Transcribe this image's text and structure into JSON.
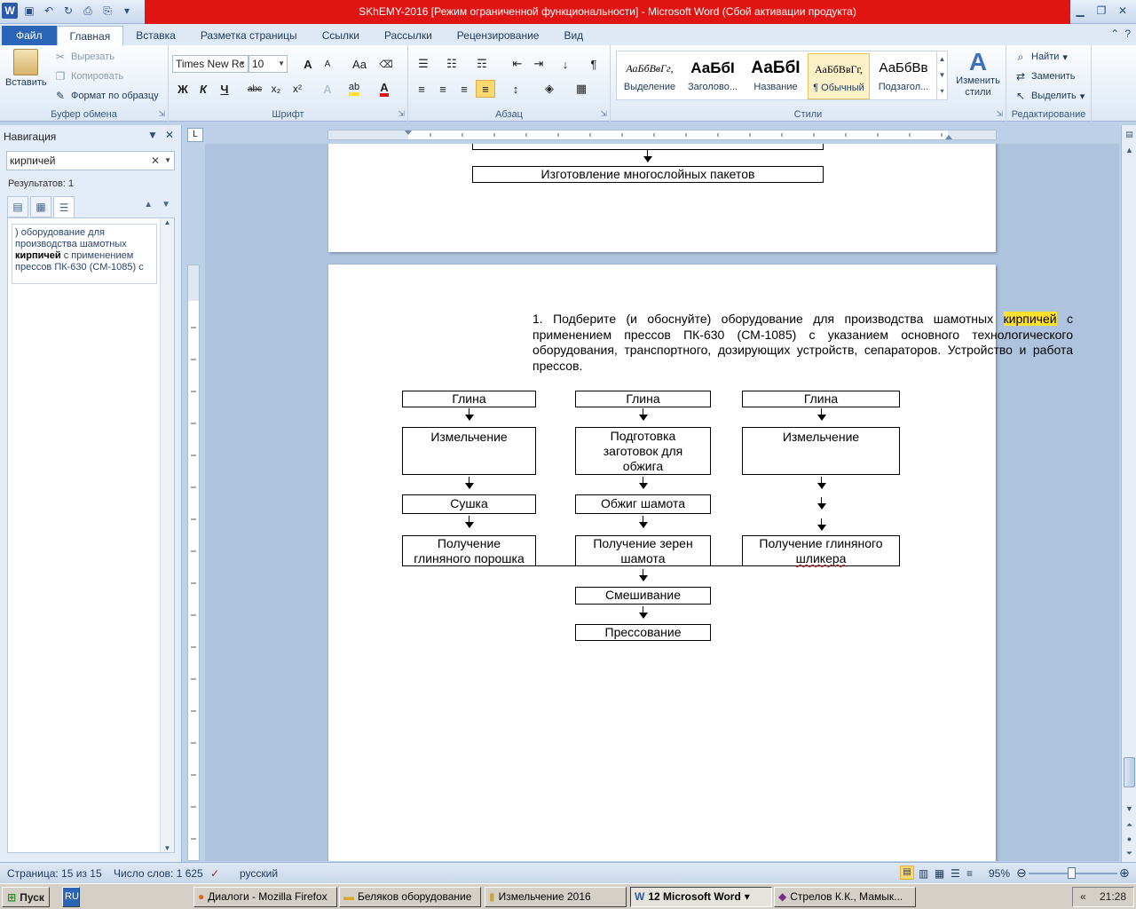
{
  "window": {
    "title": "SKhEMY-2016 [Режим ограниченной функциональности]  -  Microsoft Word (Сбой активации продукта)"
  },
  "tabs": [
    "Файл",
    "Главная",
    "Вставка",
    "Разметка страницы",
    "Ссылки",
    "Рассылки",
    "Рецензирование",
    "Вид"
  ],
  "clipboard": {
    "paste": "Вставить",
    "cut": "Вырезать",
    "copy": "Копировать",
    "format_painter": "Формат по образцу",
    "label": "Буфер обмена"
  },
  "font": {
    "name": "Times New Rc",
    "size": "10",
    "label": "Шрифт",
    "bold": "Ж",
    "italic": "К",
    "underline": "Ч",
    "strike": "abc",
    "subscript": "x₂",
    "superscript": "x²",
    "grow": "A",
    "shrink": "A",
    "case": "Aa",
    "font_color": "A"
  },
  "paragraph": {
    "label": "Абзац",
    "pilcrow": "¶"
  },
  "styles": {
    "label": "Стили",
    "items": [
      {
        "sample": "АаБбВвГг,",
        "name": "Выделение"
      },
      {
        "sample": "АаБбI",
        "name": "Заголово..."
      },
      {
        "sample": "АаБбI",
        "name": "Название"
      },
      {
        "sample": "АаБбВвГг,",
        "name": "¶ Обычный"
      },
      {
        "sample": "АаБбВв",
        "name": "Подзагол..."
      }
    ],
    "change": "Изменить стили"
  },
  "editing": {
    "label": "Редактирование",
    "find": "Найти",
    "replace": "Заменить",
    "select": "Выделить"
  },
  "navigation": {
    "title": "Навигация",
    "search_value": "кирпичей",
    "results": "Результатов: 1",
    "result_pre": ") оборудование для производства шамотных ",
    "result_bold": "кирпичей",
    "result_post": " с применением прессов ПК-630 (СМ-1085) с"
  },
  "document": {
    "prev_page_box": "Изготовление многослойных пакетов",
    "para_pre": "1. Подберите (и обоснуйте) оборудование для производства шамотных ",
    "para_highlight": "кирпичей",
    "para_post": " с применением прессов ПК-630 (СМ-1085) с указанием основного технологического оборудования, транспортного, дозирующих устройств, сепараторов. Устройство и работа прессов.",
    "col1": [
      "Глина",
      "Измельчение",
      "Сушка",
      "Получение глиняного порошка"
    ],
    "col2": [
      "Глина",
      "Подготовка заготовок для обжига",
      "Обжиг шамота",
      "Получение зерен шамота"
    ],
    "col3": [
      "Глина",
      "Измельчение",
      "Получение глиняного ",
      "шликера"
    ],
    "mix": "Смешивание",
    "press": "Прессование"
  },
  "status": {
    "page": "Страница: 15 из 15",
    "words": "Число слов: 1 625",
    "lang": "русский",
    "zoom": "95%"
  },
  "taskbar": {
    "start": "Пуск",
    "lang": "RU",
    "items": [
      "Диалоги - Mozilla Firefox",
      "Беляков оборудование",
      "Измельчение 2016",
      "12 Microsoft Word",
      "Стрелов К.К., Мамык..."
    ],
    "clock": "21:28"
  }
}
